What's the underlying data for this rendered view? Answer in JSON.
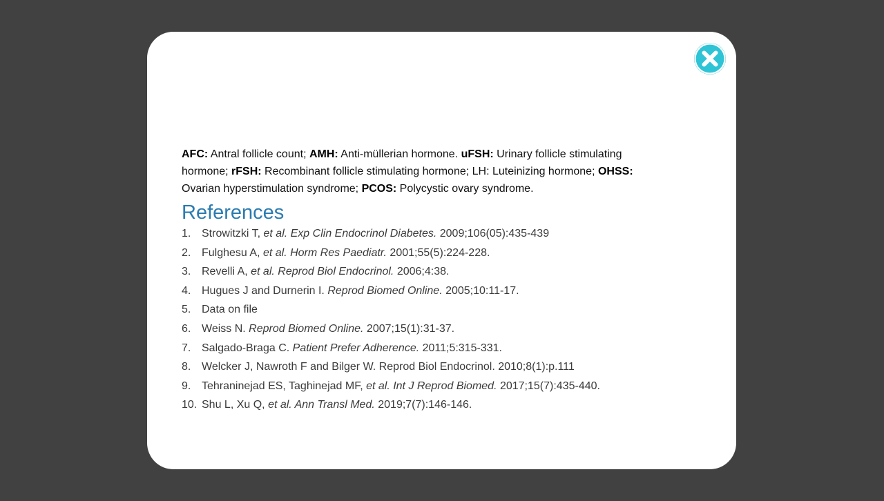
{
  "close": {
    "icon": "close-icon",
    "color": "#2ec4d6"
  },
  "abbreviations": {
    "afc_term": "AFC:",
    "afc_def": " Antral follicle count; ",
    "amh_term": "AMH:",
    "amh_def": " Anti-müllerian hormone. ",
    "ufsh_term": "uFSH:",
    "ufsh_def": " Urinary follicle stimulating hormone; ",
    "rfsh_term": "rFSH:",
    "rfsh_def": " Recombinant follicle stimulating hormone; LH: Luteinizing hormone; ",
    "ohss_term": "OHSS:",
    "ohss_def": " Ovarian hyperstimulation syndrome; ",
    "pcos_term": "PCOS:",
    "pcos_def": " Polycystic ovary syndrome."
  },
  "references": {
    "title": "References",
    "title_color": "#2b7bb0",
    "items": [
      {
        "num": "1.",
        "pre": "Strowitzki T, ",
        "ital": "et al. Exp Clin Endocrinol Diabetes.",
        "post": " 2009;106(05):435-439"
      },
      {
        "num": "2.",
        "pre": "Fulghesu A, ",
        "ital": "et al. Horm Res Paediatr.",
        "post": " 2001;55(5):224-228."
      },
      {
        "num": "3.",
        "pre": "Revelli A, ",
        "ital": "et al. Reprod Biol Endocrinol.",
        "post": " 2006;4:38."
      },
      {
        "num": "4.",
        "pre": "Hugues J and Durnerin I. ",
        "ital": "Reprod Biomed Online.",
        "post": " 2005;10:11-17."
      },
      {
        "num": "5.",
        "pre": "Data on file",
        "ital": "",
        "post": ""
      },
      {
        "num": "6.",
        "pre": "Weiss N. ",
        "ital": "Reprod Biomed Online.",
        "post": " 2007;15(1):31-37."
      },
      {
        "num": "7.",
        "pre": "Salgado-Braga C. ",
        "ital": "Patient Prefer Adherence.",
        "post": " 2011;5:315-331."
      },
      {
        "num": "8.",
        "pre": "Welcker J, Nawroth F and Bilger W. Reprod Biol Endocrinol. 2010;8(1):p.111",
        "ital": "",
        "post": ""
      },
      {
        "num": "9.",
        "pre": "Tehraninejad ES, Taghinejad MF, ",
        "ital": "et al. Int J Reprod Biomed.",
        "post": " 2017;15(7):435-440."
      },
      {
        "num": "10.",
        "pre": "Shu L, Xu Q, ",
        "ital": "et al. Ann Transl Med.",
        "post": " 2019;7(7):146-146."
      }
    ]
  }
}
